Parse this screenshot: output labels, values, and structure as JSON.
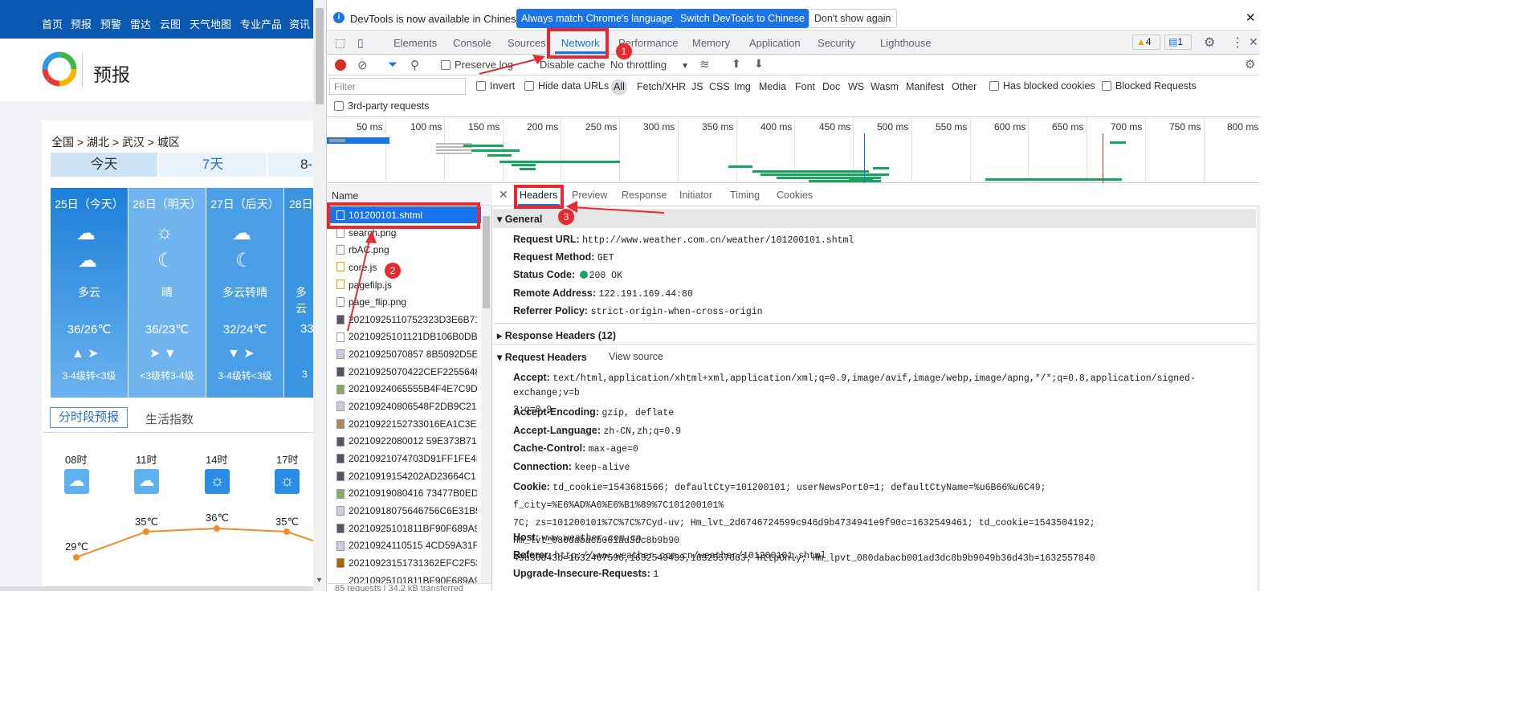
{
  "site": {
    "nav": [
      "首页",
      "预报",
      "预警",
      "雷达",
      "云图",
      "天气地图",
      "专业产品",
      "资讯"
    ],
    "title": "预报",
    "breadcrumb": "全国 > 湖北 > 武汉 > 城区",
    "tabs": [
      "今天",
      "7天",
      "8-"
    ],
    "days": [
      {
        "date": "25日（今天）",
        "weather": "多云",
        "temp": "36/26℃",
        "wind": "3-4级转<3级"
      },
      {
        "date": "26日（明天）",
        "weather": "晴",
        "temp": "36/23℃",
        "wind": "<3级转3-4级"
      },
      {
        "date": "27日（后天）",
        "weather": "多云转晴",
        "temp": "32/24℃",
        "wind": "3-4级转<3级"
      },
      {
        "date": "28日",
        "weather": "多云",
        "temp": "33",
        "wind": "3"
      }
    ],
    "subtabs": [
      "分时段预报",
      "生活指数"
    ],
    "hours": [
      "08时",
      "11时",
      "14时",
      "17时"
    ],
    "hour_temps": [
      "29℃",
      "35℃",
      "36℃",
      "35℃"
    ]
  },
  "devtools": {
    "banner": {
      "text": "DevTools is now available in Chinese!",
      "btn1": "Always match Chrome's language",
      "btn2": "Switch DevTools to Chinese",
      "btn3": "Don't show again"
    },
    "tabs": [
      "Elements",
      "Console",
      "Sources",
      "Network",
      "Performance",
      "Memory",
      "Application",
      "Security",
      "Lighthouse"
    ],
    "warn_count": "4",
    "msg_count": "1",
    "toolbar": {
      "preserve": "Preserve log",
      "disable": "Disable cache",
      "throttle": "No throttling"
    },
    "filter": {
      "placeholder": "Filter",
      "invert": "Invert",
      "hide": "Hide data URLs",
      "types": [
        "All",
        "Fetch/XHR",
        "JS",
        "CSS",
        "Img",
        "Media",
        "Font",
        "Doc",
        "WS",
        "Wasm",
        "Manifest",
        "Other"
      ],
      "blocked_cookies": "Has blocked cookies",
      "blocked_req": "Blocked Requests",
      "third": "3rd-party requests"
    },
    "ticks": [
      "50 ms",
      "100 ms",
      "150 ms",
      "200 ms",
      "250 ms",
      "300 ms",
      "350 ms",
      "400 ms",
      "450 ms",
      "500 ms",
      "550 ms",
      "600 ms",
      "650 ms",
      "700 ms",
      "750 ms",
      "800 ms"
    ],
    "name_header": "Name",
    "requests": [
      "101200101.shtml",
      "search.png",
      "rbAC.png",
      "core.js",
      "pagefilp.js",
      "page_flip.png",
      "20210925110752323D3E6B712",
      "20210925101121DB106B0DB",
      "20210925070857 8B5092D5E",
      "20210925070422CEF2255648",
      "20210924065555B4F4E7C9DA",
      "202109240806548F2DB9C212",
      "20210922152733016EA1C3ED",
      "20210922080012 59E373B71A",
      "20210921074703D91FF1FE4F",
      "20210919154202AD23664C1.",
      "20210919080416 73477B0ED5",
      "20210918075646756C6E31B5",
      "20210925101811BF90F689A9",
      "20210924110515 4CD59A31F.",
      "20210923151731362EFC2F53",
      "20210925101811BF90F689A9"
    ],
    "status": {
      "requests": "85 requests",
      "transferred": "34.2 kB transferred"
    },
    "detail_tabs": [
      "Headers",
      "Preview",
      "Response",
      "Initiator",
      "Timing",
      "Cookies"
    ],
    "general_title": "General",
    "general": [
      [
        "Request URL:",
        "http://www.weather.com.cn/weather/101200101.shtml"
      ],
      [
        "Request Method:",
        "GET"
      ],
      [
        "Status Code:",
        "200 OK"
      ],
      [
        "Remote Address:",
        "122.191.169.44:80"
      ],
      [
        "Referrer Policy:",
        "strict-origin-when-cross-origin"
      ]
    ],
    "resp_headers": "Response Headers (12)",
    "req_headers": "Request Headers",
    "view_source": "View source",
    "headers": [
      [
        "Accept:",
        "text/html,application/xhtml+xml,application/xml;q=0.9,image/avif,image/webp,image/apng,*/*;q=0.8,application/signed-exchange;v=b",
        "3;q=0.9"
      ],
      [
        "Accept-Encoding:",
        "gzip, deflate",
        ""
      ],
      [
        "Accept-Language:",
        "zh-CN,zh;q=0.9",
        ""
      ],
      [
        "Cache-Control:",
        "max-age=0",
        ""
      ],
      [
        "Connection:",
        "keep-alive",
        ""
      ],
      [
        "Cookie:",
        "td_cookie=1543681566; defaultCty=101200101; userNewsPort0=1; defaultCtyName=%u6B66%u6C49; f_city=%E6%AD%A6%E6%B1%89%7C101200101%",
        "7C; zs=101200101%7C%7C%7Cyd-uv; Hm_lvt_2d6746724599c946d9b4734941e9f90c=1632549461; td_cookie=1543504192; Hm_lvt_080dabacb001ad3dc8b9b90",
        "49b36d43b=1632467596,1632549439,1632557663; HttpOnly; Hm_lpvt_080dabacb001ad3dc8b9b9049b36d43b=1632557840"
      ],
      [
        "Host:",
        "www.weather.com.cn",
        ""
      ],
      [
        "Referer:",
        "http://www.weather.com.cn/weather/101200101.shtml",
        ""
      ],
      [
        "Upgrade-Insecure-Requests:",
        "1",
        ""
      ]
    ],
    "annotations": [
      "1",
      "2",
      "3"
    ]
  }
}
